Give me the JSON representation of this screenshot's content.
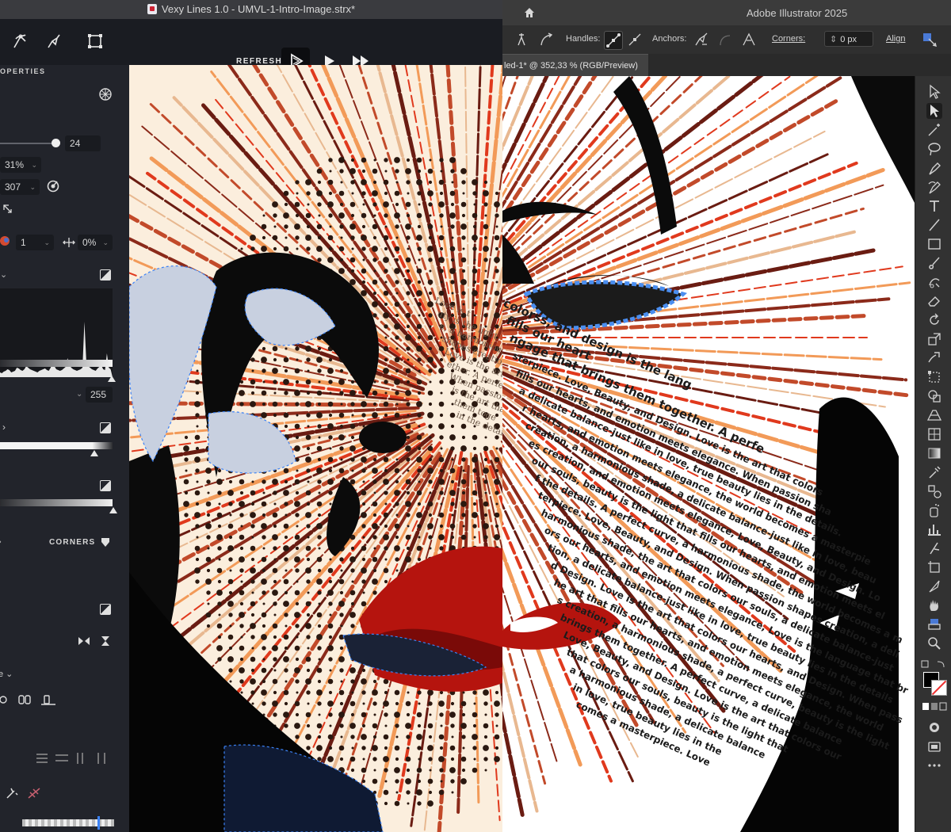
{
  "vexy": {
    "title": "Vexy Lines 1.0 - UMVL-1-Intro-Image.strx*",
    "refresh_label": "REFRESH",
    "properties_title": "OPERTIES",
    "fields": {
      "interval": "24",
      "opacity": "31%",
      "angle": "307",
      "layers": "1",
      "shift": "0%",
      "max_value": "255"
    },
    "corners_label": "CORNERS"
  },
  "illustrator": {
    "title": "Adobe Illustrator 2025",
    "handles_label": "Handles:",
    "anchors_label": "Anchors:",
    "corners_label": "Corners:",
    "corners_value": "0 px",
    "align_label": "Align",
    "doc_tab": "led-1* @ 352,33 % (RGB/Preview)"
  },
  "artwork": {
    "text_lines": [
      "colorss, and design is the lang",
      "fills our heart",
      "ngage that brings them together. A perfe",
      "sterpiece. Love, Beauty, and Design. Love is the art that colors",
      "fills our hearts, and emotion meets elegance. When passion sha",
      "a delicate balance-just like in love, true beauty lies in the details.",
      "r hearts, and emotion meets elegance, the world becomes a masterpie",
      "creation, a harmonious shade, a delicate balance-just like in love, beau",
      "es creation, and emotion meets elegance, Love, Beauty, and Design. Lo",
      "our souls, beauty is the light that fills our hearts, and emotion meets el",
      "f the details. A perfect curve, a harmonious shade, the world becomes a m",
      "terpiece. Love, Beauty, and Design. When passion shapes creation, a deli",
      "harmonious shade, the art that colors our souls, a delicate balance-just",
      "ors our hearts, and emotion meets elegance, Love is the language that br",
      "tion, a delicate balance-just like in love, true beauty lies in the details",
      "d Design. Love is the art that colors our hearts, and Design. When pass",
      "he art that fills our hearts, and emotion meets elegance, the world",
      "s creation, a harmonious shade, a perfect curve, beauty is the light",
      "brings them together. A perfect curve, a delicate balance",
      "Love, Beauty, and Design. Love is the art that colors our",
      "that colors our souls, beauty is the light that",
      "a harmonious shade, a delicate balance",
      "in love, true beauty lies in the",
      "comes a masterpiece. Love"
    ],
    "left_text_lines": [
      "Love is t",
      "uty is the light",
      "e, a harmonious shade",
      "shapes creation, and",
      "Love is the art tha",
      "ether. A perfect curve",
      "When passion shap",
      "is the art tha",
      "them toge",
      "in the details"
    ]
  },
  "colors": {
    "vexy_bg": "#1d1f26",
    "vexy_panel": "#22242b",
    "ai_bg": "#323232",
    "selection_blue": "#3b82f6",
    "lip_red": "#b5140e",
    "ray_red": "#e0391d",
    "ray_orange": "#f29a58",
    "cream": "#fbeedd"
  }
}
